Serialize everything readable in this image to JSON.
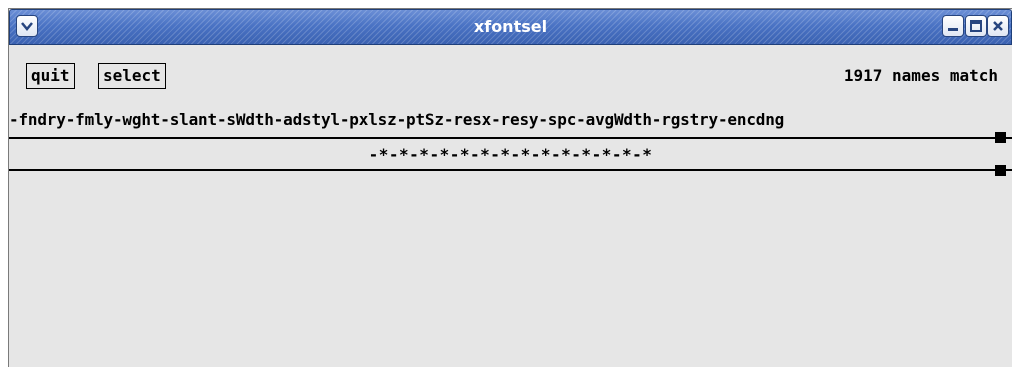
{
  "window": {
    "title": "xfontsel"
  },
  "titlebar": {
    "buttons": [
      {
        "icon": "chevron-down-icon"
      },
      {
        "icon": "minimize-icon"
      },
      {
        "icon": "maximize-icon"
      },
      {
        "icon": "close-icon"
      }
    ]
  },
  "toolbar": {
    "quit_label": "quit",
    "select_label": "select",
    "match_count": "1917 names match"
  },
  "pattern": {
    "fields_text": "-fndry-fmly-wght-slant-sWdth-adstyl-pxlsz-ptSz-resx-resy-spc-avgWdth-rgstry-encdng"
  },
  "font_name": {
    "text": "-*-*-*-*-*-*-*-*-*-*-*-*-*-*"
  },
  "colors": {
    "titlebar": "#4a73c4",
    "background": "#e6e6e6",
    "text": "#000000"
  }
}
